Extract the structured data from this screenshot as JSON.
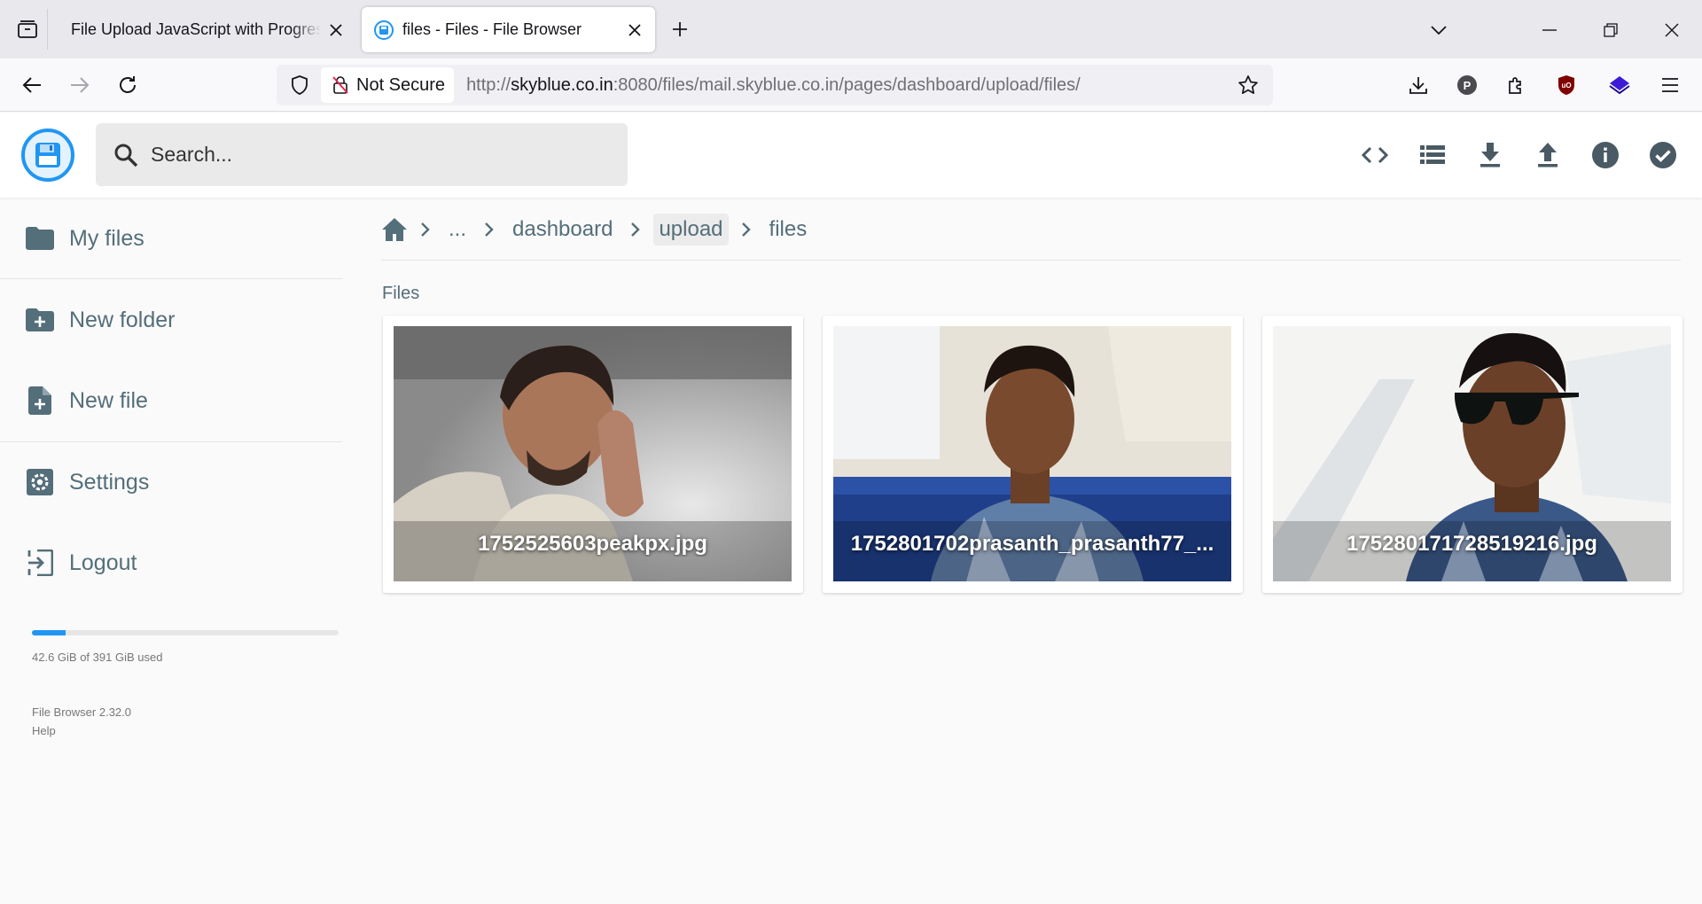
{
  "browser": {
    "tabs": [
      {
        "title": "File Upload JavaScript with Progress Bar",
        "active": false
      },
      {
        "title": "files - Files - File Browser",
        "active": true
      }
    ],
    "security_label": "Not Secure",
    "url_prefix": "http://",
    "url_host": "skyblue.co.in",
    "url_rest": ":8080/files/mail.skyblue.co.in/pages/dashboard/upload/files/",
    "extension_badge": "P"
  },
  "header": {
    "search_placeholder": "Search..."
  },
  "sidebar": {
    "items": [
      {
        "label": "My files",
        "icon": "folder-icon"
      },
      {
        "label": "New folder",
        "icon": "create-new-folder-icon"
      },
      {
        "label": "New file",
        "icon": "note-add-icon"
      },
      {
        "label": "Settings",
        "icon": "settings-icon"
      },
      {
        "label": "Logout",
        "icon": "exit-icon"
      }
    ],
    "usage_text": "42.6 GiB of 391 GiB used",
    "usage_fraction": 0.109,
    "version": "File Browser 2.32.0",
    "help": "Help"
  },
  "breadcrumb": {
    "items": [
      "...",
      "dashboard",
      "upload",
      "files"
    ]
  },
  "main": {
    "section_title": "Files",
    "files": [
      {
        "name": "1752525603peakpx.jpg"
      },
      {
        "name": "1752801702prasanth_prasanth77_..."
      },
      {
        "name": "175280171728519216.jpg"
      }
    ]
  },
  "colors": {
    "accent": "#2196f3",
    "icon_gray": "#546e7a",
    "header_icon": "#4a5a64"
  }
}
